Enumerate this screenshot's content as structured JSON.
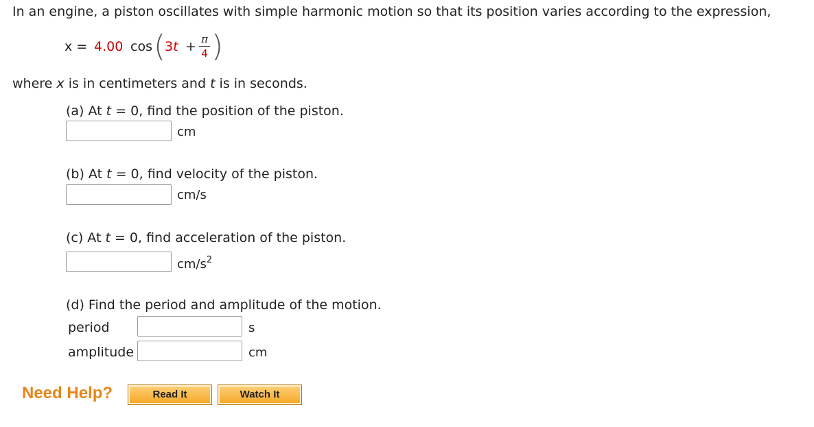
{
  "intro": "In an engine, a piston oscillates with simple harmonic motion so that its position varies according to the expression,",
  "equation": {
    "lhs": "x =",
    "coefficient": "4.00",
    "func": "cos",
    "arg_coef": "3",
    "arg_var": "t",
    "plus": "+",
    "frac_num": "π",
    "frac_den": "4"
  },
  "where": {
    "prefix": "where ",
    "x": "x",
    "middle": " is in centimeters and ",
    "t": "t",
    "suffix": " is in seconds."
  },
  "parts": {
    "a": {
      "pre": "(a) At ",
      "var": "t",
      "post": " = 0, find the position of the piston.",
      "unit": "cm",
      "value": ""
    },
    "b": {
      "pre": "(b) At ",
      "var": "t",
      "post": " = 0, find velocity of the piston.",
      "unit": "cm/s",
      "value": ""
    },
    "c": {
      "pre": "(c) At ",
      "var": "t",
      "post": " = 0, find acceleration of the piston.",
      "unit": "cm/s",
      "unit_exp": "2",
      "value": ""
    },
    "d": {
      "text": "(d) Find the period and amplitude of the motion.",
      "period_label": "period",
      "period_unit": "s",
      "period_value": "",
      "amplitude_label": "amplitude",
      "amplitude_unit": "cm",
      "amplitude_value": ""
    }
  },
  "help": {
    "label": "Need Help?",
    "read_it": "Read It",
    "watch_it": "Watch It"
  },
  "colors": {
    "help_orange": "#e8861a",
    "highlight_red": "#cc0000",
    "button_orange": "#f5a623"
  }
}
